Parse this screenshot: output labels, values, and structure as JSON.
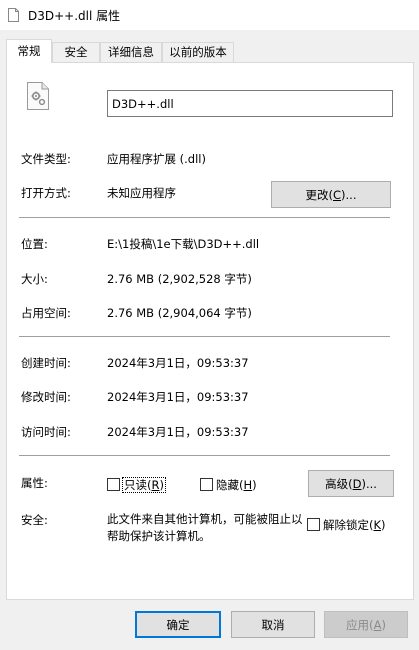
{
  "window": {
    "title": "D3D++.dll 属性"
  },
  "tabs": [
    "常规",
    "安全",
    "详细信息",
    "以前的版本"
  ],
  "file": {
    "name": "D3D++.dll"
  },
  "props": {
    "type_label": "文件类型:",
    "type_value": "应用程序扩展 (.dll)",
    "open_label": "打开方式:",
    "open_value": "未知应用程序",
    "change_button": {
      "text": "更改(",
      "key": "C",
      "suffix": ")..."
    },
    "location_label": "位置:",
    "location_value": "E:\\1投稿\\1e下载\\D3D++.dll",
    "size_label": "大小:",
    "size_value": "2.76 MB (2,902,528 字节)",
    "disk_label": "占用空间:",
    "disk_value": "2.76 MB (2,904,064 字节)",
    "created_label": "创建时间:",
    "created_value": "2024年3月1日，09:53:37",
    "modified_label": "修改时间:",
    "modified_value": "2024年3月1日，09:53:37",
    "accessed_label": "访问时间:",
    "accessed_value": "2024年3月1日，09:53:37",
    "attr_label": "属性:",
    "readonly": {
      "text": "只读(",
      "key": "R",
      "suffix": ")"
    },
    "hidden": {
      "text": "隐藏(",
      "key": "H",
      "suffix": ")"
    },
    "advanced_button": {
      "text": "高级(",
      "key": "D",
      "suffix": ")..."
    },
    "security_label": "安全:",
    "security_text": "此文件来自其他计算机，可能被阻止以帮助保护该计算机。",
    "unblock": {
      "text": "解除锁定(",
      "key": "K",
      "suffix": ")"
    }
  },
  "footer": {
    "ok": "确定",
    "cancel": "取消",
    "apply": {
      "text": "应用(",
      "key": "A",
      "suffix": ")"
    }
  }
}
